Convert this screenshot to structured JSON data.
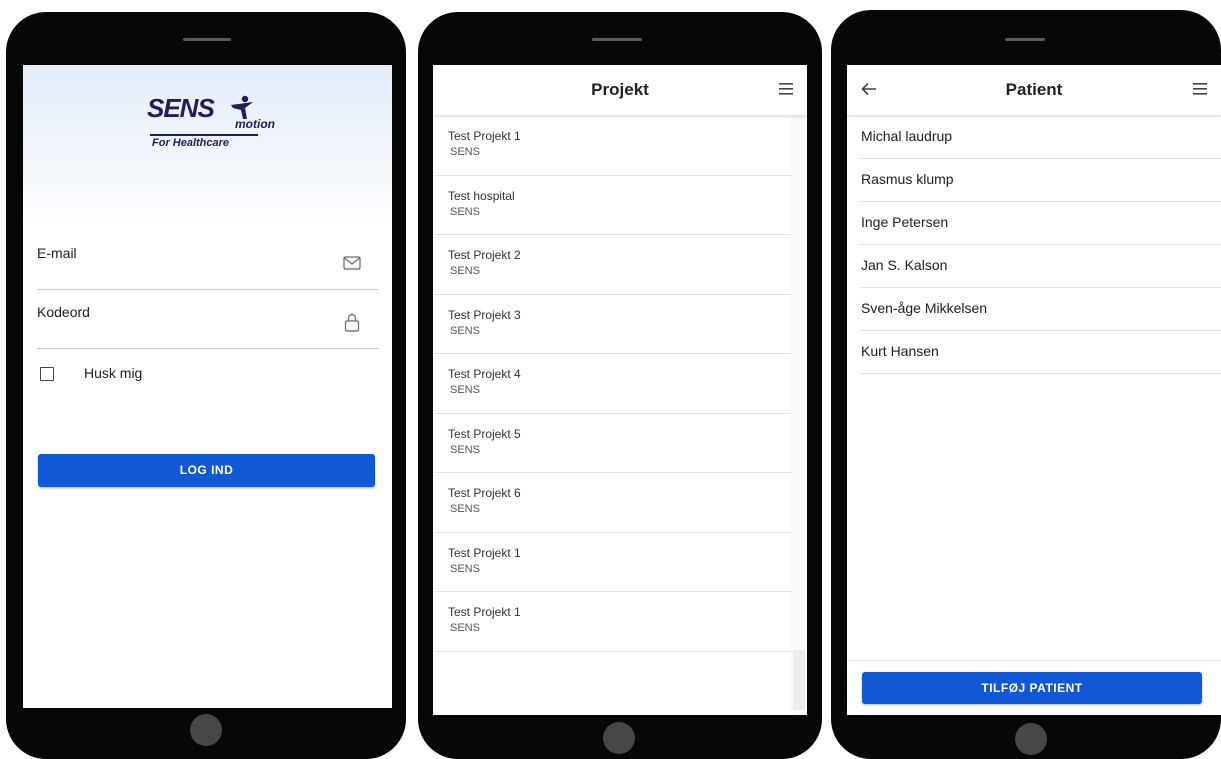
{
  "login": {
    "logo": {
      "brand": "SENS",
      "sub": "motion",
      "tagline": "For Healthcare"
    },
    "email_label": "E-mail",
    "password_label": "Kodeord",
    "remember_label": "Husk mig",
    "remember_checked": false,
    "login_button": "LOG IND"
  },
  "projects": {
    "title": "Projekt",
    "items": [
      {
        "title": "Test Projekt 1",
        "sub": "SENS"
      },
      {
        "title": "Test hospital",
        "sub": "SENS"
      },
      {
        "title": "Test Projekt 2",
        "sub": "SENS"
      },
      {
        "title": "Test Projekt 3",
        "sub": "SENS"
      },
      {
        "title": "Test Projekt 4",
        "sub": "SENS"
      },
      {
        "title": "Test Projekt 5",
        "sub": "SENS"
      },
      {
        "title": "Test Projekt 6",
        "sub": "SENS"
      },
      {
        "title": "Test Projekt 1",
        "sub": "SENS"
      },
      {
        "title": "Test Projekt 1",
        "sub": "SENS"
      }
    ]
  },
  "patients": {
    "title": "Patient",
    "items": [
      {
        "name": "Michal laudrup"
      },
      {
        "name": "Rasmus klump"
      },
      {
        "name": "Inge Petersen"
      },
      {
        "name": "Jan S. Kalson"
      },
      {
        "name": "Sven-åge Mikkelsen"
      },
      {
        "name": "Kurt Hansen"
      }
    ],
    "add_button": "TILFØJ PATIENT"
  },
  "colors": {
    "primary": "#1158d6",
    "logo": "#1d1d5f",
    "phone_frame": "#070707"
  },
  "icons": [
    "mail-icon",
    "lock-icon",
    "menu-icon",
    "back-arrow-icon"
  ]
}
